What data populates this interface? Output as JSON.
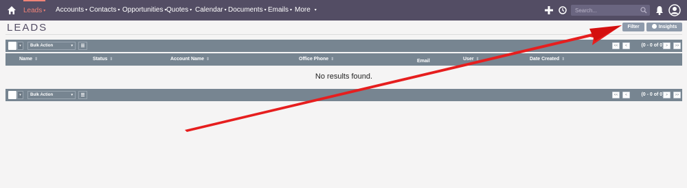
{
  "nav": {
    "items": [
      {
        "label": "Leads",
        "active": true
      },
      {
        "label": "Accounts"
      },
      {
        "label": "Contacts"
      },
      {
        "label": "Opportunities"
      },
      {
        "label": "Quotes"
      },
      {
        "label": "Calendar"
      },
      {
        "label": "Documents"
      },
      {
        "label": "Emails"
      },
      {
        "label": "More"
      }
    ],
    "caret": "▾",
    "search_placeholder": "Search..."
  },
  "page": {
    "title": "LEADS",
    "filter_label": "Filter",
    "insights_label": "Insights"
  },
  "list": {
    "bulk_action_label": "Bulk Action",
    "pagination_text": "(0 - 0 of 0)",
    "pager": {
      "first": "<<",
      "prev": "<",
      "next": ">",
      "last": ">>"
    },
    "columns": [
      {
        "label": "Name",
        "sortable": true
      },
      {
        "label": "Status",
        "sortable": true
      },
      {
        "label": "Account Name",
        "sortable": true
      },
      {
        "label": "Office Phone",
        "sortable": true
      },
      {
        "label": "Email",
        "sortable": false
      },
      {
        "label": "User",
        "sortable": true
      },
      {
        "label": "Date Created",
        "sortable": true
      }
    ],
    "empty_message": "No results found."
  },
  "colors": {
    "topnav_bg": "#534d64",
    "active_nav": "#f08377",
    "bar_bg": "#778591",
    "annotation_arrow": "#ff0000"
  },
  "icons": [
    "home-icon",
    "plus-icon",
    "history-icon",
    "search-icon",
    "bell-icon",
    "user-avatar-icon",
    "insights-icon"
  ]
}
